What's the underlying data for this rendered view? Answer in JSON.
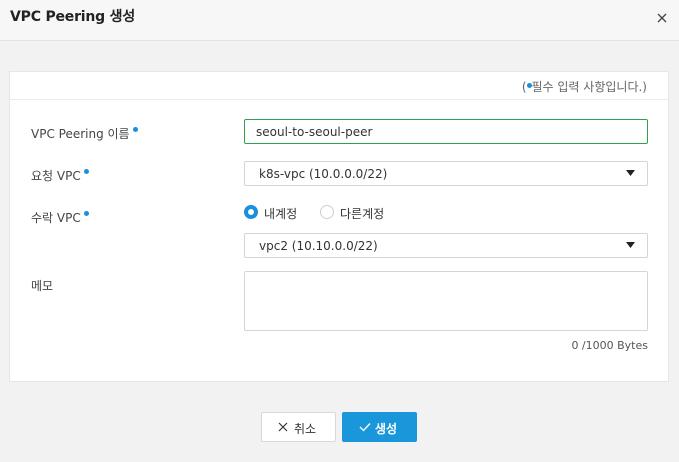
{
  "dialog": {
    "title": "VPC Peering 생성"
  },
  "form": {
    "required_note_open": "(",
    "required_note_text": "필수 입력 사항입니다.)",
    "name": {
      "label": "VPC Peering 이름",
      "value": "seoul-to-seoul-peer"
    },
    "request_vpc": {
      "label": "요청 VPC",
      "selected": "k8s-vpc (10.0.0.0/22)"
    },
    "accept_vpc": {
      "label": "수락 VPC",
      "account_options": [
        {
          "label": "내계정",
          "checked": true
        },
        {
          "label": "다른계정",
          "checked": false
        }
      ],
      "selected": "vpc2 (10.10.0.0/22)"
    },
    "memo": {
      "label": "메모",
      "value": "",
      "counter": "0 /1000 Bytes"
    }
  },
  "actions": {
    "cancel_label": "취소",
    "create_label": "생성"
  },
  "colors": {
    "accent": "#1a97db",
    "required_dot": "#1a8fde",
    "valid_border": "#2e9e4f"
  },
  "icons": {
    "close": "close-icon",
    "dropdown": "caret-down-icon",
    "cancel": "x-icon",
    "create": "check-icon"
  }
}
